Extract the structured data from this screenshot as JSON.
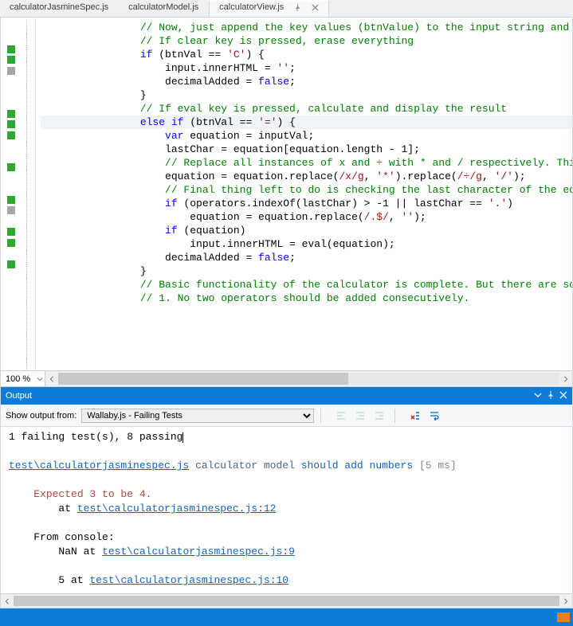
{
  "tabs": [
    {
      "label": "calculatorJasmineSpec.js",
      "active": false
    },
    {
      "label": "calculatorModel.js",
      "active": false
    },
    {
      "label": "calculatorView.js",
      "active": true
    }
  ],
  "editor": {
    "zoom": "100 %",
    "lines": [
      {
        "m": "none",
        "cls": "c",
        "indent": 4,
        "text": "// Now, just append the key values (btnValue) to the input string and finally u"
      },
      {
        "m": "none",
        "cls": "c",
        "indent": 4,
        "text": "// If clear key is pressed, erase everything"
      },
      {
        "m": "green",
        "cls": "",
        "indent": 4,
        "raw": "<span class='k'>if</span> (btnVal == <span class='s'>'C'</span>) {"
      },
      {
        "m": "green",
        "cls": "",
        "indent": 5,
        "raw": "input.innerHTML = <span class='s'>''</span>;"
      },
      {
        "m": "gray",
        "cls": "",
        "indent": 5,
        "raw": "decimalAdded = <span class='k'>false</span>;"
      },
      {
        "m": "none",
        "cls": "",
        "indent": 4,
        "text": "}"
      },
      {
        "m": "none",
        "cls": "",
        "indent": 0,
        "text": ""
      },
      {
        "m": "none",
        "cls": "c",
        "indent": 4,
        "text": "// If eval key is pressed, calculate and display the result"
      },
      {
        "m": "green",
        "cls": "",
        "indent": 4,
        "current": true,
        "raw": "<span class='k'>else</span> <span class='k'>if</span> (btnVal == <span class='s'>'='</span>) {"
      },
      {
        "m": "green",
        "cls": "",
        "indent": 5,
        "raw": "<span class='k'>var</span> equation = inputVal;"
      },
      {
        "m": "green",
        "cls": "",
        "indent": 5,
        "raw": "lastChar = equation[equation.length - 1];"
      },
      {
        "m": "none",
        "cls": "",
        "indent": 0,
        "text": ""
      },
      {
        "m": "none",
        "cls": "c",
        "indent": 5,
        "text": "// Replace all instances of x and ÷ with * and / respectively. This can be"
      },
      {
        "m": "green",
        "cls": "",
        "indent": 5,
        "raw": "equation = equation.replace(<span class='s'>/x/g</span>, <span class='s'>'*'</span>).replace(<span class='s'>/÷/g</span>, <span class='s'>'/'</span>);"
      },
      {
        "m": "none",
        "cls": "",
        "indent": 0,
        "text": ""
      },
      {
        "m": "none",
        "cls": "c",
        "indent": 5,
        "text": "// Final thing left to do is checking the last character of the equation. "
      },
      {
        "m": "green",
        "cls": "",
        "indent": 5,
        "raw": "<span class='k'>if</span> (operators.indexOf(lastChar) &gt; -1 || lastChar == <span class='s'>'.'</span>)"
      },
      {
        "m": "gray",
        "cls": "",
        "indent": 6,
        "raw": "equation = equation.replace(<span class='s'>/.$/</span>, <span class='s'>''</span>);"
      },
      {
        "m": "none",
        "cls": "",
        "indent": 0,
        "text": ""
      },
      {
        "m": "green",
        "cls": "",
        "indent": 5,
        "raw": "<span class='k'>if</span> (equation)"
      },
      {
        "m": "green",
        "cls": "",
        "indent": 6,
        "raw": "input.innerHTML = eval(equation);"
      },
      {
        "m": "none",
        "cls": "",
        "indent": 0,
        "text": ""
      },
      {
        "m": "green",
        "cls": "",
        "indent": 5,
        "raw": "decimalAdded = <span class='k'>false</span>;"
      },
      {
        "m": "none",
        "cls": "",
        "indent": 4,
        "text": "}"
      },
      {
        "m": "none",
        "cls": "",
        "indent": 0,
        "text": ""
      },
      {
        "m": "none",
        "cls": "c",
        "indent": 4,
        "text": "// Basic functionality of the calculator is complete. But there are some probl"
      },
      {
        "m": "none",
        "cls": "c",
        "indent": 4,
        "text": "// 1. No two operators should be added consecutively."
      }
    ]
  },
  "output": {
    "title": "Output",
    "show_label": "Show output from:",
    "source": "Wallaby.js - Failing Tests",
    "summary": "1 failing test(s), 8 passing",
    "test_file": "test\\calculatorjasminespec.js",
    "test_spec": "calculator model",
    "test_name": "should add numbers",
    "test_ms": "[5 ms]",
    "expected": "Expected 3 to be 4.",
    "at_label": "at",
    "stack1": "test\\calculatorjasminespec.js:12",
    "from_console": "From console:",
    "nan_label": "NaN at",
    "stack2": "test\\calculatorjasminespec.js:9",
    "five_label": "5 at",
    "stack3": "test\\calculatorjasminespec.js:10"
  }
}
